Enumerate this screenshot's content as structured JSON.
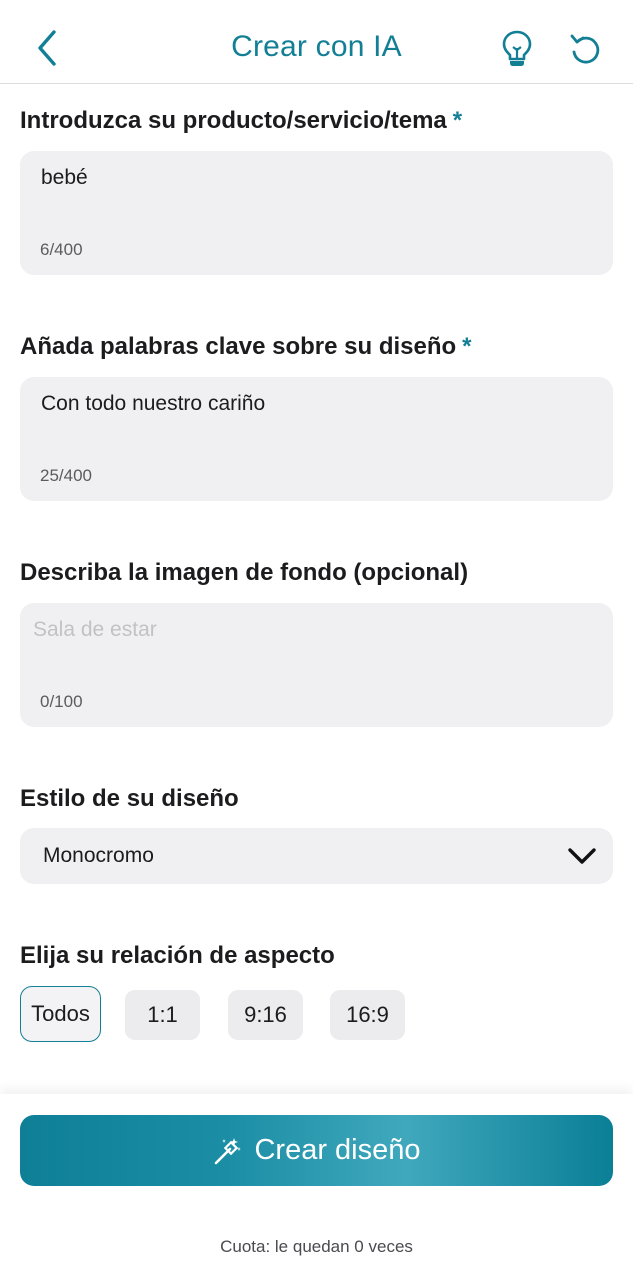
{
  "header": {
    "title": "Crear con IA",
    "back_icon": "chevron-left-icon",
    "tips_icon": "lightbulb-icon",
    "reset_icon": "rotate-ccw-icon",
    "accent_color": "#127f95"
  },
  "product": {
    "label": "Introduzca su producto/servicio/tema",
    "required_mark": "*",
    "value": "bebé",
    "counter": "6/400"
  },
  "keywords": {
    "label": "Añada palabras clave sobre su diseño",
    "required_mark": "*",
    "value": "Con todo nuestro cariño",
    "counter": "25/400"
  },
  "background": {
    "label": "Describa la imagen de fondo (opcional)",
    "placeholder": "Sala de estar",
    "counter": "0/100"
  },
  "style": {
    "label": "Estilo de su diseño",
    "value": "Monocromo",
    "dropdown_icon": "chevron-down-icon"
  },
  "aspect": {
    "label": "Elija su relación de aspecto",
    "options": [
      "Todos",
      "1:1",
      "9:16",
      "16:9"
    ],
    "selected": "Todos"
  },
  "footer": {
    "cta_label": "Crear diseño",
    "cta_icon": "magic-wand-icon",
    "quota_text": "Cuota: le quedan 0 veces"
  }
}
